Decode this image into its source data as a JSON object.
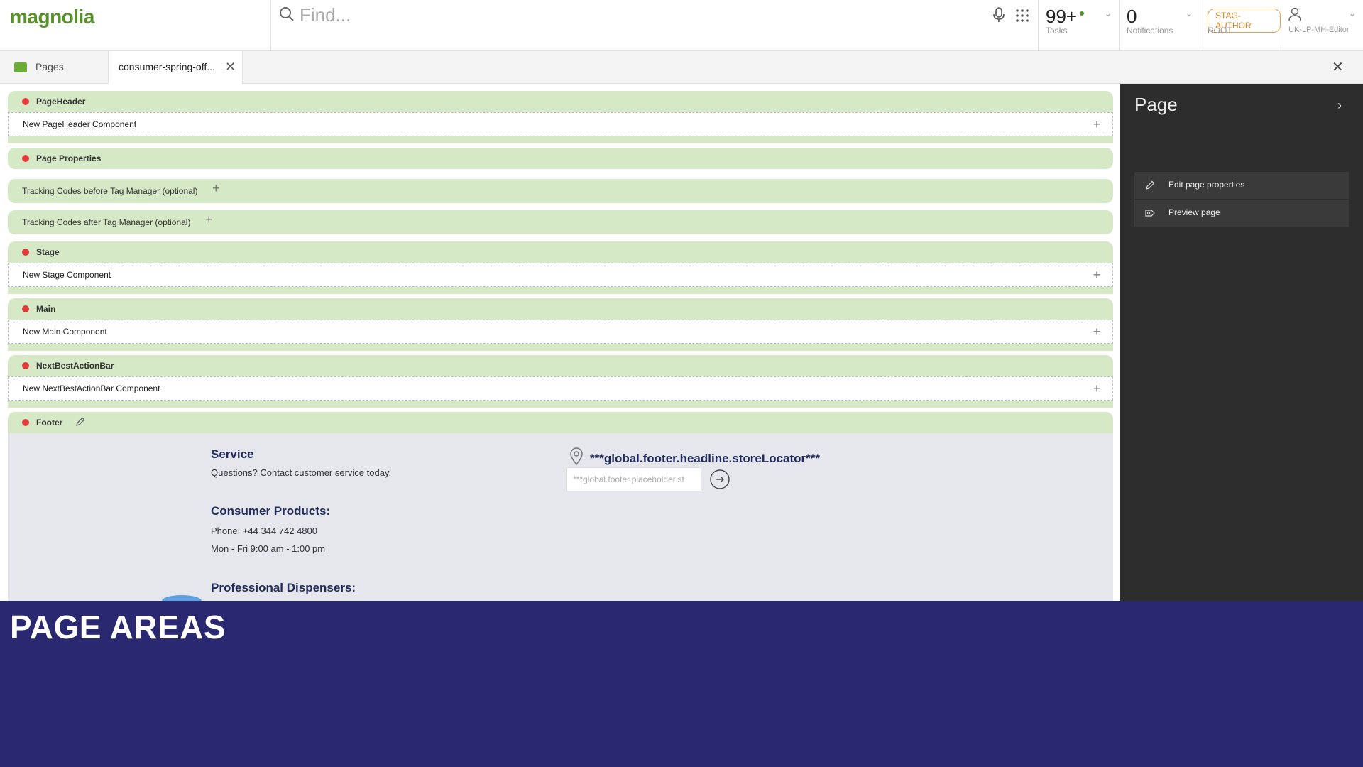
{
  "app": {
    "logo_text": "magnolia"
  },
  "search": {
    "placeholder": "Find...",
    "search_icon": "search-icon",
    "mic_icon": "microphone-icon",
    "apps_icon": "app-launcher-icon"
  },
  "top_tiles": {
    "tasks": {
      "value": "99+",
      "label": "Tasks"
    },
    "notifications": {
      "value": "0",
      "label": "Notifications"
    },
    "env": {
      "badge": "STAG-AUTHOR",
      "label": "ROOT"
    },
    "user": {
      "label": "UK-LP-MH-Editor",
      "icon": "user-icon"
    }
  },
  "tabs": {
    "pages": {
      "label": "Pages"
    },
    "document": {
      "label": "consumer-spring-off..."
    }
  },
  "areas": {
    "page_header": {
      "title": "PageHeader",
      "slot": "New PageHeader Component"
    },
    "page_properties": {
      "title": "Page Properties"
    },
    "tracking_before": {
      "title": "Tracking Codes before Tag Manager (optional)"
    },
    "tracking_after": {
      "title": "Tracking Codes after Tag Manager (optional)"
    },
    "stage": {
      "title": "Stage",
      "slot": "New Stage Component"
    },
    "main": {
      "title": "Main",
      "slot": "New Main Component"
    },
    "nba": {
      "title": "NextBestActionBar",
      "slot": "New NextBestActionBar Component"
    },
    "footer": {
      "title": "Footer"
    }
  },
  "footer": {
    "service_heading": "Service",
    "service_text": "Questions? Contact customer service today.",
    "consumer_heading": "Consumer Products:",
    "consumer_phone": "Phone: +44 344 742 4800",
    "consumer_hours": "Mon - Fri 9:00 am - 1:00 pm",
    "professional_heading": "Professional Dispensers:",
    "store_heading": "***global.footer.headline.storeLocator***",
    "store_placeholder": "***global.footer.placeholder.st"
  },
  "right_panel": {
    "title": "Page",
    "actions": [
      {
        "label": "Edit page properties",
        "icon": "pencil-icon"
      },
      {
        "label": "Preview page",
        "icon": "preview-icon"
      }
    ]
  },
  "banner": {
    "title": "PAGE AREAS"
  },
  "colors": {
    "brand": "#5a8f2e",
    "area_green": "#d6e9c6",
    "banner": "#292870",
    "panel": "#2d2d2d",
    "bullet": "#e03b3b"
  }
}
